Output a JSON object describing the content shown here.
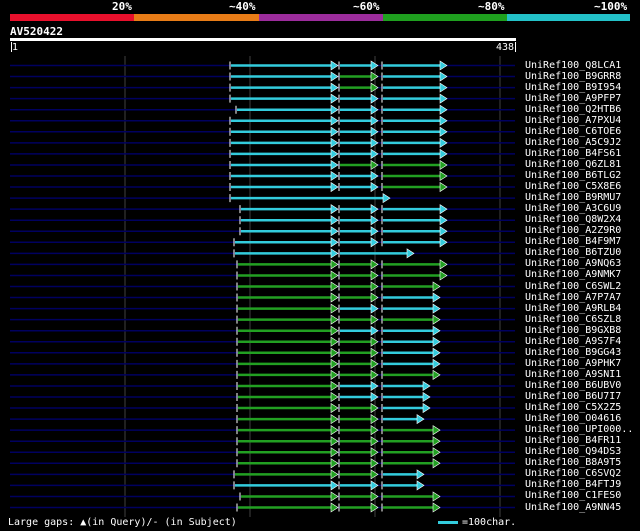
{
  "scale": {
    "labels": [
      "20%",
      "~40%",
      "~60%",
      "~80%",
      "~100%"
    ],
    "colors": [
      "#E8102C",
      "#E87C17",
      "#9C2C9C",
      "#1FA01F",
      "#23C1C8"
    ]
  },
  "query": {
    "id": "AV520422",
    "start": "1",
    "end": "438",
    "length": 438
  },
  "colors": {
    "cyan": "#33CCDD",
    "green": "#22A022",
    "bg": "#000000",
    "trace": "#000060",
    "grid": "#404040"
  },
  "hits": [
    {
      "name": "UniRef100_Q8LCA1",
      "segs": [
        [
          230,
          338,
          "c"
        ],
        [
          339,
          378,
          "c"
        ],
        [
          382,
          447,
          "c"
        ]
      ]
    },
    {
      "name": "UniRef100_B9GRR8",
      "segs": [
        [
          230,
          338,
          "c"
        ],
        [
          339,
          378,
          "g"
        ],
        [
          382,
          447,
          "c"
        ]
      ]
    },
    {
      "name": "UniRef100_B9I954",
      "segs": [
        [
          230,
          338,
          "c"
        ],
        [
          339,
          378,
          "g"
        ],
        [
          382,
          447,
          "c"
        ]
      ]
    },
    {
      "name": "UniRef100_A9PFP7",
      "segs": [
        [
          230,
          338,
          "c"
        ],
        [
          339,
          378,
          "c"
        ],
        [
          382,
          447,
          "c"
        ]
      ]
    },
    {
      "name": "UniRef100_Q2HTB6",
      "segs": [
        [
          236,
          338,
          "c"
        ],
        [
          339,
          378,
          "c"
        ],
        [
          382,
          447,
          "c"
        ]
      ]
    },
    {
      "name": "UniRef100_A7PXU4",
      "segs": [
        [
          230,
          338,
          "c"
        ],
        [
          339,
          378,
          "c"
        ],
        [
          382,
          447,
          "c"
        ]
      ]
    },
    {
      "name": "UniRef100_C6TOE6",
      "segs": [
        [
          230,
          338,
          "c"
        ],
        [
          339,
          378,
          "c"
        ],
        [
          382,
          447,
          "c"
        ]
      ]
    },
    {
      "name": "UniRef100_A5C9J2",
      "segs": [
        [
          230,
          338,
          "c"
        ],
        [
          339,
          378,
          "c"
        ],
        [
          382,
          447,
          "c"
        ]
      ]
    },
    {
      "name": "UniRef100_B4FS61",
      "segs": [
        [
          230,
          338,
          "c"
        ],
        [
          339,
          378,
          "c"
        ],
        [
          382,
          447,
          "c"
        ]
      ]
    },
    {
      "name": "UniRef100_Q6ZL81",
      "segs": [
        [
          230,
          338,
          "c"
        ],
        [
          339,
          378,
          "g"
        ],
        [
          382,
          447,
          "g"
        ]
      ]
    },
    {
      "name": "UniRef100_B6TLG2",
      "segs": [
        [
          230,
          338,
          "c"
        ],
        [
          339,
          378,
          "c"
        ],
        [
          382,
          447,
          "g"
        ]
      ]
    },
    {
      "name": "UniRef100_C5X8E6",
      "segs": [
        [
          230,
          338,
          "c"
        ],
        [
          339,
          378,
          "c"
        ],
        [
          382,
          447,
          "g"
        ]
      ]
    },
    {
      "name": "UniRef100_B9RMU7",
      "segs": [
        [
          230,
          390,
          "c"
        ]
      ]
    },
    {
      "name": "UniRef100_A3C6U9",
      "segs": [
        [
          240,
          338,
          "c"
        ],
        [
          339,
          378,
          "c"
        ],
        [
          382,
          447,
          "c"
        ]
      ]
    },
    {
      "name": "UniRef100_Q8W2X4",
      "segs": [
        [
          240,
          338,
          "c"
        ],
        [
          339,
          378,
          "c"
        ],
        [
          382,
          447,
          "c"
        ]
      ]
    },
    {
      "name": "UniRef100_A2Z9R0",
      "segs": [
        [
          240,
          338,
          "c"
        ],
        [
          339,
          378,
          "c"
        ],
        [
          382,
          447,
          "c"
        ]
      ]
    },
    {
      "name": "UniRef100_B4F9M7",
      "segs": [
        [
          234,
          338,
          "c"
        ],
        [
          339,
          378,
          "c"
        ],
        [
          382,
          447,
          "c"
        ]
      ]
    },
    {
      "name": "UniRef100_B6TZU0",
      "segs": [
        [
          234,
          338,
          "c"
        ],
        [
          339,
          414,
          "c"
        ]
      ]
    },
    {
      "name": "UniRef100_A9NQ63",
      "segs": [
        [
          237,
          338,
          "g"
        ],
        [
          339,
          378,
          "g"
        ],
        [
          382,
          447,
          "g"
        ]
      ]
    },
    {
      "name": "UniRef100_A9NMK7",
      "segs": [
        [
          237,
          338,
          "g"
        ],
        [
          339,
          378,
          "g"
        ],
        [
          382,
          447,
          "g"
        ]
      ]
    },
    {
      "name": "UniRef100_C6SWL2",
      "segs": [
        [
          237,
          338,
          "g"
        ],
        [
          339,
          378,
          "g"
        ],
        [
          382,
          440,
          "g"
        ]
      ]
    },
    {
      "name": "UniRef100_A7P7A7",
      "segs": [
        [
          237,
          338,
          "g"
        ],
        [
          339,
          378,
          "g"
        ],
        [
          382,
          440,
          "c"
        ]
      ]
    },
    {
      "name": "UniRef100_A9RLB4",
      "segs": [
        [
          237,
          338,
          "g"
        ],
        [
          339,
          378,
          "c"
        ],
        [
          382,
          440,
          "c"
        ]
      ]
    },
    {
      "name": "UniRef100_C6SZL8",
      "segs": [
        [
          237,
          338,
          "g"
        ],
        [
          339,
          378,
          "g"
        ],
        [
          382,
          440,
          "g"
        ]
      ]
    },
    {
      "name": "UniRef100_B9GXB8",
      "segs": [
        [
          237,
          338,
          "g"
        ],
        [
          339,
          378,
          "c"
        ],
        [
          382,
          440,
          "c"
        ]
      ]
    },
    {
      "name": "UniRef100_A9S7F4",
      "segs": [
        [
          237,
          338,
          "g"
        ],
        [
          339,
          378,
          "g"
        ],
        [
          382,
          440,
          "c"
        ]
      ]
    },
    {
      "name": "UniRef100_B9GG43",
      "segs": [
        [
          237,
          338,
          "g"
        ],
        [
          339,
          378,
          "g"
        ],
        [
          382,
          440,
          "c"
        ]
      ]
    },
    {
      "name": "UniRef100_A9PHK7",
      "segs": [
        [
          237,
          338,
          "g"
        ],
        [
          339,
          378,
          "g"
        ],
        [
          382,
          440,
          "c"
        ]
      ]
    },
    {
      "name": "UniRef100_A9SNI1",
      "segs": [
        [
          237,
          338,
          "g"
        ],
        [
          339,
          378,
          "g"
        ],
        [
          382,
          440,
          "g"
        ]
      ]
    },
    {
      "name": "UniRef100_B6UBV0",
      "segs": [
        [
          237,
          338,
          "g"
        ],
        [
          339,
          378,
          "c"
        ],
        [
          382,
          430,
          "c"
        ]
      ]
    },
    {
      "name": "UniRef100_B6U7I7",
      "segs": [
        [
          237,
          338,
          "g"
        ],
        [
          339,
          378,
          "c"
        ],
        [
          382,
          430,
          "c"
        ]
      ]
    },
    {
      "name": "UniRef100_C5X2Z5",
      "segs": [
        [
          237,
          338,
          "g"
        ],
        [
          339,
          378,
          "g"
        ],
        [
          382,
          430,
          "c"
        ]
      ]
    },
    {
      "name": "UniRef100_O04616",
      "segs": [
        [
          237,
          338,
          "g"
        ],
        [
          339,
          378,
          "g"
        ],
        [
          382,
          424,
          "c"
        ]
      ]
    },
    {
      "name": "UniRef100_UPI000..",
      "segs": [
        [
          237,
          338,
          "g"
        ],
        [
          339,
          378,
          "g"
        ],
        [
          382,
          440,
          "g"
        ]
      ]
    },
    {
      "name": "UniRef100_B4FR11",
      "segs": [
        [
          237,
          338,
          "g"
        ],
        [
          339,
          378,
          "g"
        ],
        [
          382,
          440,
          "g"
        ]
      ]
    },
    {
      "name": "UniRef100_Q94DS3",
      "segs": [
        [
          237,
          338,
          "g"
        ],
        [
          339,
          378,
          "g"
        ],
        [
          382,
          440,
          "g"
        ]
      ]
    },
    {
      "name": "UniRef100_B8A9T5",
      "segs": [
        [
          237,
          338,
          "g"
        ],
        [
          339,
          378,
          "g"
        ],
        [
          382,
          440,
          "g"
        ]
      ]
    },
    {
      "name": "UniRef100_C6SVQ2",
      "segs": [
        [
          234,
          338,
          "g"
        ],
        [
          339,
          378,
          "g"
        ],
        [
          382,
          424,
          "c"
        ]
      ]
    },
    {
      "name": "UniRef100_B4FTJ9",
      "segs": [
        [
          234,
          338,
          "c"
        ],
        [
          339,
          378,
          "c"
        ],
        [
          382,
          424,
          "c"
        ]
      ]
    },
    {
      "name": "UniRef100_C1FES0",
      "segs": [
        [
          240,
          338,
          "g"
        ],
        [
          339,
          378,
          "g"
        ],
        [
          382,
          440,
          "g"
        ]
      ]
    },
    {
      "name": "UniRef100_A9NN45",
      "segs": [
        [
          237,
          338,
          "g"
        ],
        [
          339,
          378,
          "g"
        ],
        [
          382,
          440,
          "g"
        ]
      ]
    }
  ],
  "footer": {
    "gaps": "Large gaps: ▲(in Query)/- (in Subject)",
    "scale": "=100char."
  }
}
